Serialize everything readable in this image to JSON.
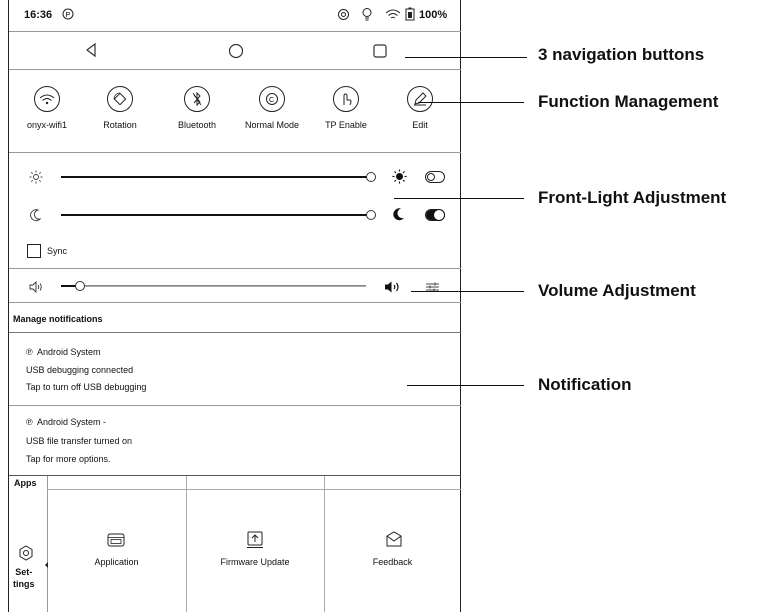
{
  "status_bar": {
    "time": "16:36",
    "battery": "100%"
  },
  "quick_settings": [
    {
      "label": "onyx-wifi1",
      "icon": "wifi-icon"
    },
    {
      "label": "Rotation",
      "icon": "rotation-icon"
    },
    {
      "label": "Bluetooth",
      "icon": "bluetooth-icon"
    },
    {
      "label": "Normal Mode",
      "icon": "refresh-mode-icon"
    },
    {
      "label": "TP Enable",
      "icon": "touch-icon"
    },
    {
      "label": "Edit",
      "icon": "pencil-icon"
    }
  ],
  "front_light": {
    "sync_label": "Sync"
  },
  "notifications": {
    "header": "Manage notifications",
    "items": [
      {
        "source": "Android System",
        "title": "USB debugging connected",
        "body": "Tap to turn off USB debugging"
      },
      {
        "source": "Android System -",
        "title": "USB file transfer turned on",
        "body": "Tap for more options."
      }
    ]
  },
  "background_app": {
    "apps_label": "Apps",
    "settings_label": "Set-\ntings",
    "items": [
      {
        "label": "Application",
        "icon": "application-icon"
      },
      {
        "label": "Firmware Update",
        "icon": "firmware-update-icon"
      },
      {
        "label": "Feedback",
        "icon": "feedback-icon"
      }
    ]
  },
  "callouts": {
    "nav": "3 navigation buttons",
    "function": "Function Management",
    "front_light": "Front-Light Adjustment",
    "volume": "Volume Adjustment",
    "notification": "Notification"
  }
}
